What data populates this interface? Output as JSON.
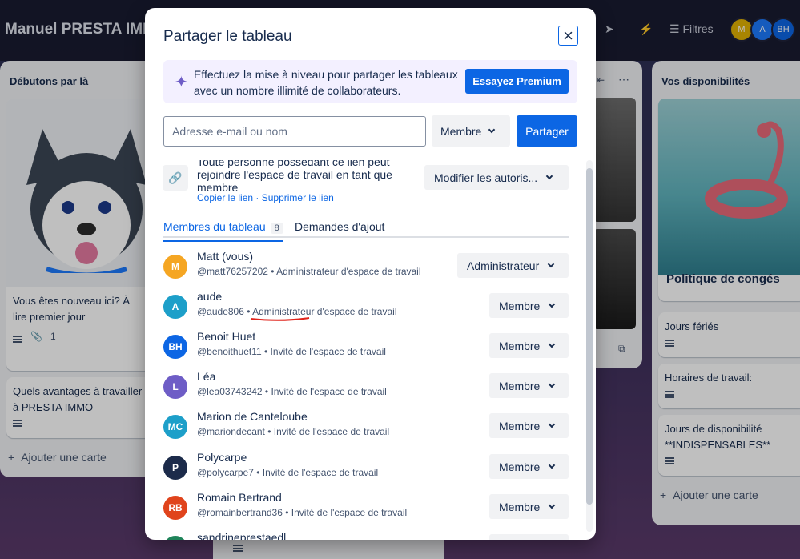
{
  "board": {
    "title": "Manuel PRESTA IMMO",
    "filters_label": "Filtres",
    "avatars": [
      {
        "initials": "M",
        "color": "#e2b203"
      },
      {
        "initials": "A",
        "color": "#1d7afc"
      },
      {
        "initials": "BH",
        "color": "#0c66e4"
      }
    ],
    "lists": {
      "left": {
        "title": "Débutons par là",
        "card1_text": "Vous êtes nouveau ici? À lire premier jour",
        "card1_attachments": "1",
        "card2_text": "Quels avantages à travailler à PRESTA IMMO",
        "add_card": "Ajouter une carte"
      },
      "right": {
        "title": "Vos disponibilités",
        "card_cover_title": "Politique de congés",
        "cards": [
          "Jours fériés",
          "Horaires de travail:",
          "Jours de disponibilité **INDISPENSABLES**"
        ],
        "add_card": "Ajouter une carte"
      }
    }
  },
  "modal": {
    "title": "Partager le tableau",
    "promo": {
      "text": "Effectuez la mise à niveau pour partager les tableaux avec un nombre illimité de collaborateurs.",
      "button": "Essayez Premium"
    },
    "invite": {
      "placeholder": "Adresse e-mail ou nom",
      "role": "Membre",
      "share_button": "Partager"
    },
    "link": {
      "text": "Toute personne possédant ce lien peut rejoindre l'espace de travail en tant que membre",
      "copy": "Copier le lien",
      "separator": " · ",
      "delete": "Supprimer le lien",
      "permissions_button": "Modifier les autoris..."
    },
    "tabs": {
      "members_label": "Membres du tableau",
      "members_count": "8",
      "requests_label": "Demandes d'ajout"
    },
    "members": [
      {
        "initials": "M",
        "color": "#f5a623",
        "name": "Matt (vous)",
        "sub": "@matt76257202 • Administrateur d'espace de travail",
        "role": "Administrateur"
      },
      {
        "initials": "A",
        "color": "#1d9fc9",
        "name": "aude",
        "sub": "@aude806 • Administrateur d'espace de travail",
        "role": "Membre"
      },
      {
        "initials": "BH",
        "color": "#0c66e4",
        "name": "Benoit Huet",
        "sub": "@benoithuet11 • Invité de l'espace de travail",
        "role": "Membre"
      },
      {
        "initials": "L",
        "color": "#6e5dc6",
        "name": "Léa",
        "sub": "@lea03743242 • Invité de l'espace de travail",
        "role": "Membre"
      },
      {
        "initials": "MC",
        "color": "#1d9fc9",
        "name": "Marion de Canteloube",
        "sub": "@mariondecant • Invité de l'espace de travail",
        "role": "Membre"
      },
      {
        "initials": "P",
        "color": "#1c2b4a",
        "name": "Polycarpe",
        "sub": "@polycarpe7 • Invité de l'espace de travail",
        "role": "Membre"
      },
      {
        "initials": "RB",
        "color": "#e0441c",
        "name": "Romain Bertrand",
        "sub": "@romainbertrand36 • Invité de l'espace de travail",
        "role": "Membre"
      },
      {
        "initials": "S",
        "color": "#1f845a",
        "name": "sandrineprestaedl",
        "sub": "",
        "role": "Membre"
      }
    ]
  }
}
